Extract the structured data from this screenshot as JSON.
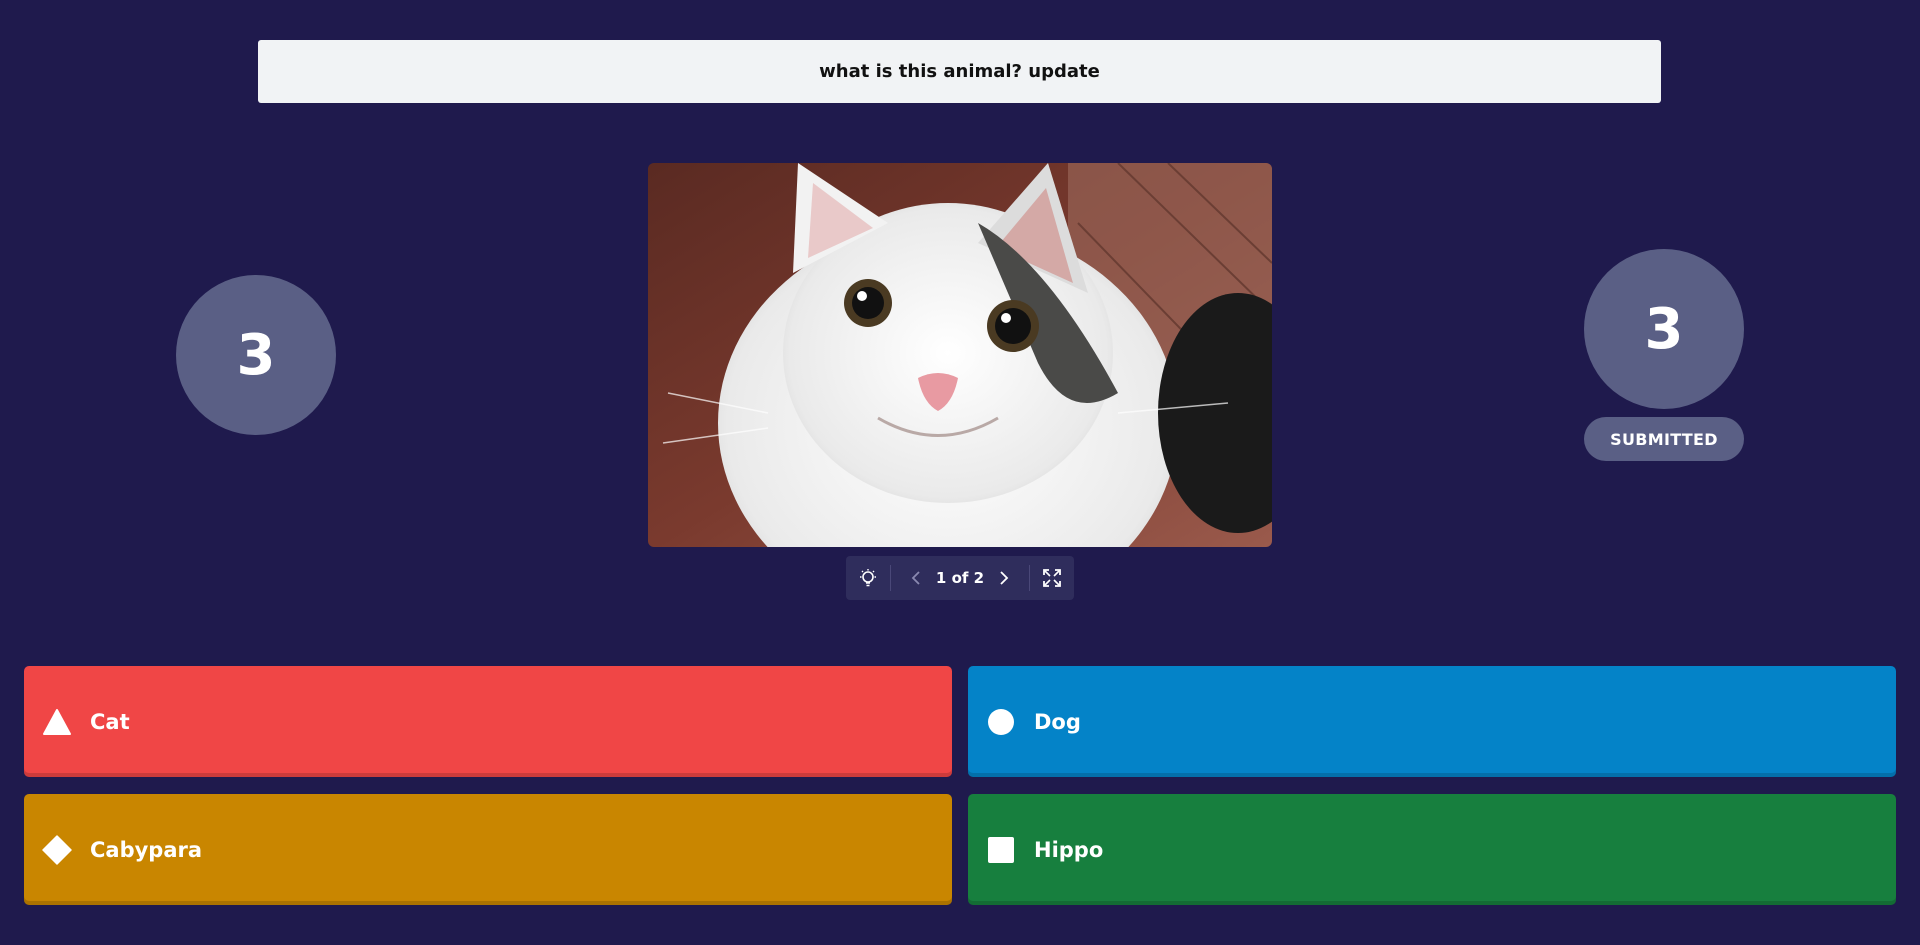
{
  "question": {
    "text": "what is this animal? update"
  },
  "timer": {
    "value": "3"
  },
  "answers_count": {
    "value": "3",
    "status": "SUBMITTED"
  },
  "media": {
    "page_indicator": "1 of 2",
    "icons": [
      "lightbulb-icon",
      "chevron-left-icon",
      "chevron-right-icon",
      "fullscreen-icon"
    ]
  },
  "answers": [
    {
      "label": "Cat",
      "shape": "triangle-icon",
      "color": "#f04646"
    },
    {
      "label": "Dog",
      "shape": "circle-icon",
      "color": "#0483c8"
    },
    {
      "label": "Cabypara",
      "shape": "diamond-icon",
      "color": "#c98600"
    },
    {
      "label": "Hippo",
      "shape": "square-icon",
      "color": "#177f3e"
    }
  ],
  "colors": {
    "background": "#1f1a4d",
    "counter": "#5a5f85"
  }
}
